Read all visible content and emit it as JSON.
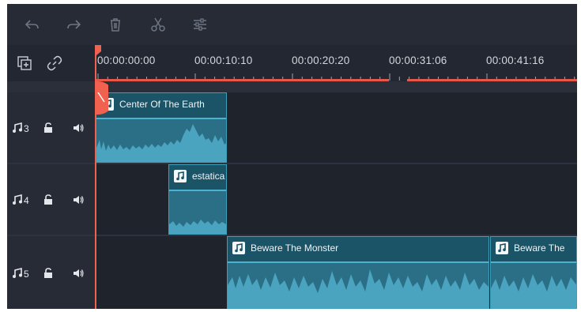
{
  "toolbar": {
    "icons": [
      "undo-icon",
      "redo-icon",
      "delete-icon",
      "cut-icon",
      "adjust-icon"
    ]
  },
  "ruler": {
    "icons": [
      "add-track-icon",
      "link-icon"
    ],
    "timecodes": [
      "00:00:00:00",
      "00:00:10:10",
      "00:00:20:20",
      "00:00:31:06",
      "00:00:41:16"
    ]
  },
  "tracks": [
    {
      "label": "3",
      "clips": [
        {
          "title": "Center Of The Earth"
        }
      ]
    },
    {
      "label": "4",
      "clips": [
        {
          "title": "estatica"
        }
      ]
    },
    {
      "label": "5",
      "clips": [
        {
          "title": "Beware The Monster"
        },
        {
          "title": "Beware The"
        }
      ]
    }
  ],
  "colors": {
    "background": "#262b35",
    "clip": "#2a6f86",
    "playhead": "#f06150"
  }
}
